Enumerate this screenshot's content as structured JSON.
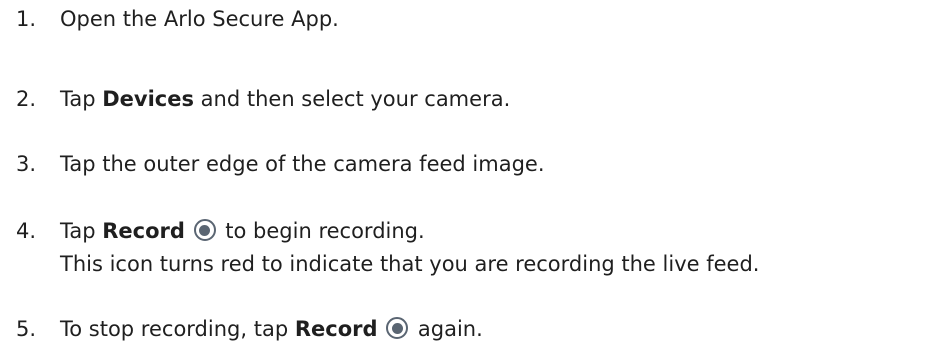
{
  "steps": [
    {
      "number": "1.",
      "text": "Open the Arlo Secure App."
    },
    {
      "number": "2.",
      "pre": "Tap ",
      "bold": "Devices",
      "post": " and then select your camera."
    },
    {
      "number": "3.",
      "text": "Tap the outer edge of the camera feed image."
    },
    {
      "number": "4.",
      "pre": "Tap ",
      "bold": "Record",
      "icon": "record-icon",
      "post": " to begin recording.",
      "note": "This icon turns red to indicate that you are recording the live feed."
    },
    {
      "number": "5.",
      "pre": "To stop recording, tap ",
      "bold": "Record",
      "icon": "record-icon",
      "post": " again."
    }
  ],
  "colors": {
    "text": "#1f1f1f",
    "icon": "#5a6572",
    "background": "#ffffff"
  }
}
